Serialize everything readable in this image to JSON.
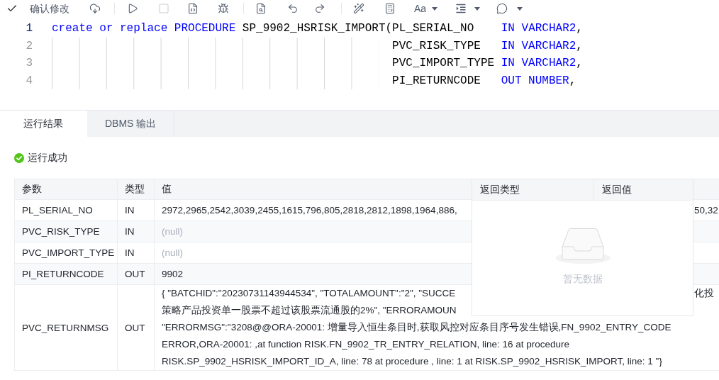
{
  "toolbar": {
    "confirm_label": "确认修改",
    "stop_button": {
      "disabled": true
    },
    "font_menu_label": "Aa"
  },
  "editor": {
    "lines": [
      {
        "number": "1",
        "active": true,
        "tokens": [
          {
            "kind": "keyword",
            "text": "create or replace PROCEDURE"
          },
          {
            "kind": "plain",
            "text": " SP_9902_HSRISK_IMPORT(PL_SERIAL_NO    "
          },
          {
            "kind": "keyword",
            "text": "IN VARCHAR2"
          },
          {
            "kind": "plain",
            "text": ","
          }
        ]
      },
      {
        "number": "2",
        "active": false,
        "tokens": [
          {
            "kind": "plain",
            "text": "                                                  PVC_RISK_TYPE   "
          },
          {
            "kind": "keyword",
            "text": "IN VARCHAR2"
          },
          {
            "kind": "plain",
            "text": ","
          }
        ]
      },
      {
        "number": "3",
        "active": false,
        "tokens": [
          {
            "kind": "plain",
            "text": "                                                  PVC_IMPORT_TYPE "
          },
          {
            "kind": "keyword",
            "text": "IN VARCHAR2"
          },
          {
            "kind": "plain",
            "text": ","
          }
        ]
      },
      {
        "number": "4",
        "active": false,
        "tokens": [
          {
            "kind": "plain",
            "text": "                                                  PI_RETURNCODE   "
          },
          {
            "kind": "keyword",
            "text": "OUT NUMBER"
          },
          {
            "kind": "plain",
            "text": ","
          }
        ]
      }
    ]
  },
  "result_tabs": [
    {
      "label": "运行结果",
      "selected": true
    },
    {
      "label": "DBMS 输出",
      "selected": false
    }
  ],
  "status": {
    "kind": "success",
    "text": "运行成功"
  },
  "params_table": {
    "columns": [
      "参数",
      "类型",
      "值"
    ],
    "rows": [
      {
        "name": "PL_SERIAL_NO",
        "type": "IN",
        "is_null": false,
        "value_lines": [
          {
            "text": "2972,2965,2542,3039,2455,1615,796,805,2818,2812,1898,1964,886,",
            "after_overlay": "50,32"
          }
        ]
      },
      {
        "name": "PVC_RISK_TYPE",
        "type": "IN",
        "is_null": true,
        "value_lines": [
          {
            "text": "(null)"
          }
        ]
      },
      {
        "name": "PVC_IMPORT_TYPE",
        "type": "IN",
        "is_null": true,
        "value_lines": [
          {
            "text": "(null)"
          }
        ]
      },
      {
        "name": "PI_RETURNCODE",
        "type": "OUT",
        "is_null": false,
        "value_lines": [
          {
            "text": "9902"
          }
        ]
      },
      {
        "name": "PVC_RETURNMSG",
        "type": "OUT",
        "is_null": false,
        "value_lines": [
          {
            "text": "{ \"BATCHID\":\"20230731143944534\", \"TOTALAMOUNT\":\"2\", \"SUCCE",
            "after_overlay": "化投"
          },
          {
            "text": "策略产品投资单一股票不超过该股票流通股的2%\", \"ERRORAMOUN"
          }
        ],
        "value_tail": "\"ERRORMSG\":\"3208@@ORA-20001: 增量导入恒生条目时,获取风控对应条目序号发生错误,FN_9902_ENTRY_CODE\nERROR,ORA-20001: ,at function RISK.FN_9902_TR_ENTRY_RELATION, line: 16 at procedure\nRISK.SP_9902_HSRISK_IMPORT_ID_A, line: 78 at procedure , line: 1 at RISK.SP_9902_HSRISK_IMPORT, line: 1 \"}"
      }
    ]
  },
  "return_table": {
    "columns": [
      "返回类型",
      "返回值"
    ],
    "empty_text": "暂无数据"
  }
}
